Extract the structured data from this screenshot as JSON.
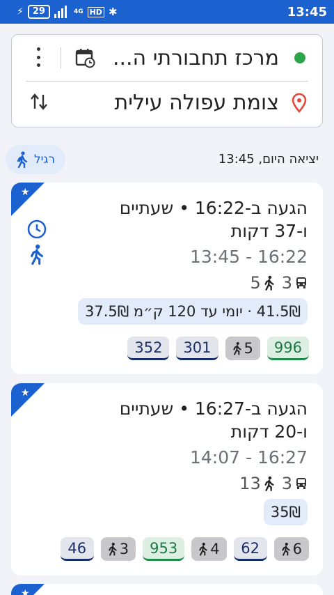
{
  "status_bar": {
    "battery": "29",
    "network": "4G",
    "hd": "HD",
    "time": "13:45"
  },
  "search": {
    "origin": "מרכז תחבורתי ה...",
    "destination": "צומת עפולה עילית"
  },
  "departure": {
    "label": "יציאה היום, 13:45"
  },
  "mode_chip": {
    "label": "רגיל"
  },
  "routes": [
    {
      "arrival": "הגעה ב-16:22 • שעתיים ו-37 דקות",
      "time_range": "13:45 - 16:22",
      "buses_count": "3",
      "walks_count": "5",
      "fare": "41.5₪ · יומי עד 120 ק״מ 37.5₪",
      "legs": [
        {
          "label": "996",
          "kind": "green"
        },
        {
          "label": "5",
          "kind": "walk"
        },
        {
          "label": "301",
          "kind": "bus"
        },
        {
          "label": "352",
          "kind": "bus"
        }
      ]
    },
    {
      "arrival": "הגעה ב-16:27 • שעתיים ו-20 דקות",
      "time_range": "14:07 - 16:27",
      "buses_count": "3",
      "walks_count": "13",
      "fare": "35₪",
      "legs": [
        {
          "label": "6",
          "kind": "walk"
        },
        {
          "label": "62",
          "kind": "bus"
        },
        {
          "label": "4",
          "kind": "walk"
        },
        {
          "label": "953",
          "kind": "green"
        },
        {
          "label": "3",
          "kind": "walk"
        },
        {
          "label": "46",
          "kind": "bus"
        }
      ]
    }
  ],
  "colors": {
    "primary": "#1c61d0",
    "origin_dot": "#2ca54a",
    "pin": "#e2473b",
    "bus_line": "#1b2f6b",
    "green_line": "#1e8c4d"
  }
}
